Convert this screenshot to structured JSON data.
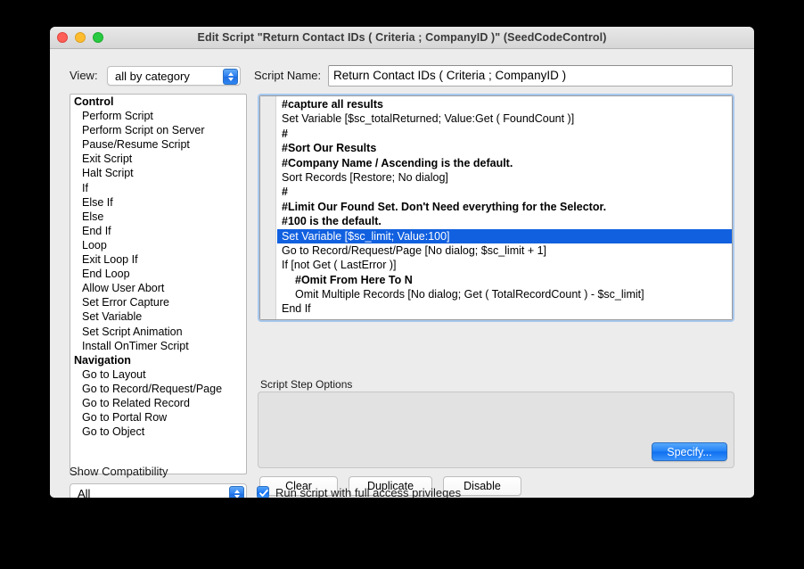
{
  "window": {
    "title": "Edit Script \"Return Contact IDs ( Criteria ; CompanyID )\" (SeedCodeControl)",
    "traffic_lights": [
      "close-button",
      "minimize-button",
      "zoom-button"
    ]
  },
  "toolbar": {
    "view_label": "View:",
    "view_value": "all by category",
    "script_name_label": "Script Name:",
    "script_name_value": "Return Contact IDs ( Criteria ; CompanyID )"
  },
  "steps_list": [
    {
      "label": "Control",
      "category": true
    },
    {
      "label": "Perform Script",
      "category": false
    },
    {
      "label": "Perform Script on Server",
      "category": false
    },
    {
      "label": "Pause/Resume Script",
      "category": false
    },
    {
      "label": "Exit Script",
      "category": false
    },
    {
      "label": "Halt Script",
      "category": false
    },
    {
      "label": "If",
      "category": false
    },
    {
      "label": "Else If",
      "category": false
    },
    {
      "label": "Else",
      "category": false
    },
    {
      "label": "End If",
      "category": false
    },
    {
      "label": "Loop",
      "category": false
    },
    {
      "label": "Exit Loop If",
      "category": false
    },
    {
      "label": "End Loop",
      "category": false
    },
    {
      "label": "Allow User Abort",
      "category": false
    },
    {
      "label": "Set Error Capture",
      "category": false
    },
    {
      "label": "Set Variable",
      "category": false
    },
    {
      "label": "Set Script Animation",
      "category": false
    },
    {
      "label": "Install OnTimer Script",
      "category": false
    },
    {
      "label": "Navigation",
      "category": true
    },
    {
      "label": "Go to Layout",
      "category": false
    },
    {
      "label": "Go to Record/Request/Page",
      "category": false
    },
    {
      "label": "Go to Related Record",
      "category": false
    },
    {
      "label": "Go to Portal Row",
      "category": false
    },
    {
      "label": "Go to Object",
      "category": false
    }
  ],
  "script_lines": [
    {
      "text": "#capture all results",
      "comment": true,
      "indent": 0,
      "selected": false
    },
    {
      "text": "Set Variable [$sc_totalReturned; Value:Get ( FoundCount )]",
      "comment": false,
      "indent": 0,
      "selected": false
    },
    {
      "text": "#",
      "comment": true,
      "indent": 0,
      "selected": false
    },
    {
      "text": "#Sort Our Results",
      "comment": true,
      "indent": 0,
      "selected": false
    },
    {
      "text": "#Company Name / Ascending is the default.",
      "comment": true,
      "indent": 0,
      "selected": false
    },
    {
      "text": "Sort Records [Restore; No dialog]",
      "comment": false,
      "indent": 0,
      "selected": false
    },
    {
      "text": "#",
      "comment": true,
      "indent": 0,
      "selected": false
    },
    {
      "text": "#Limit Our Found Set.  Don't Need everything for the Selector.",
      "comment": true,
      "indent": 0,
      "selected": false
    },
    {
      "text": "#100 is the default.",
      "comment": true,
      "indent": 0,
      "selected": false
    },
    {
      "text": "Set Variable [$sc_limit; Value:100]",
      "comment": false,
      "indent": 0,
      "selected": true
    },
    {
      "text": "Go to Record/Request/Page [No dialog; $sc_limit + 1]",
      "comment": false,
      "indent": 0,
      "selected": false
    },
    {
      "text": "If [not Get ( LastError )]",
      "comment": false,
      "indent": 0,
      "selected": false
    },
    {
      "text": "#Omit From Here To N",
      "comment": true,
      "indent": 1,
      "selected": false
    },
    {
      "text": "Omit Multiple Records [No dialog; Get ( TotalRecordCount ) - $sc_limit]",
      "comment": false,
      "indent": 1,
      "selected": false
    },
    {
      "text": "End If",
      "comment": false,
      "indent": 0,
      "selected": false
    },
    {
      "text": "#",
      "comment": true,
      "indent": 0,
      "selected": false
    }
  ],
  "options_panel": {
    "label": "Script Step Options",
    "specify_label": "Specify..."
  },
  "action_buttons": {
    "clear": "Clear",
    "duplicate": "Duplicate",
    "disable": "Disable"
  },
  "compatibility": {
    "label": "Show Compatibility",
    "value": "All"
  },
  "full_access": {
    "label": "Run script with full access privileges",
    "checked": true
  },
  "colors": {
    "selection_blue": "#1160e0",
    "accent_blue": "#2484f6",
    "window_bg": "#ececec",
    "panel_bg": "#e2e2e2"
  }
}
